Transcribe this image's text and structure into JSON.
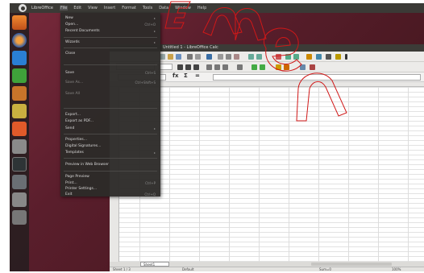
{
  "top_panel": {
    "app_title": "LibreOffice",
    "menus": [
      "File",
      "Edit",
      "View",
      "Insert",
      "Format",
      "Tools",
      "Data",
      "Window",
      "Help"
    ]
  },
  "window": {
    "title": "Untitled 1 - LibreOffice Calc"
  },
  "formula_bar": {
    "function_label": "fx",
    "sum_label": "Σ",
    "equals_label": "="
  },
  "file_menu": {
    "items": [
      {
        "label": "New",
        "shortcut": "▸"
      },
      {
        "label": "Open...",
        "shortcut": "Ctrl+O"
      },
      {
        "label": "Recent Documents",
        "shortcut": "▸"
      },
      {
        "label": "Wizards",
        "shortcut": "▸"
      },
      {
        "label": "Close",
        "shortcut": ""
      },
      {
        "label": "Save",
        "shortcut": "Ctrl+S"
      },
      {
        "label": "Save As...",
        "shortcut": "Ctrl+Shift+S"
      },
      {
        "label": "Save All",
        "shortcut": ""
      },
      {
        "label": "Export...",
        "shortcut": ""
      },
      {
        "label": "Export as PDF...",
        "shortcut": ""
      },
      {
        "label": "Send",
        "shortcut": "▸"
      },
      {
        "label": "Properties...",
        "shortcut": ""
      },
      {
        "label": "Digital Signatures...",
        "shortcut": ""
      },
      {
        "label": "Templates",
        "shortcut": "▸"
      },
      {
        "label": "Preview in Web Browser",
        "shortcut": ""
      },
      {
        "label": "Page Preview",
        "shortcut": ""
      },
      {
        "label": "Print...",
        "shortcut": "Ctrl+P"
      },
      {
        "label": "Printer Settings...",
        "shortcut": ""
      },
      {
        "label": "Exit",
        "shortcut": "Ctrl+Q"
      }
    ]
  },
  "sheet_tabs": {
    "active": "Sheet1"
  },
  "status_bar": {
    "sheet": "Sheet 1 / 3",
    "style": "Default",
    "zoom": "100%",
    "sum": "Sum=0"
  },
  "watermark": {
    "text": "Emen"
  }
}
